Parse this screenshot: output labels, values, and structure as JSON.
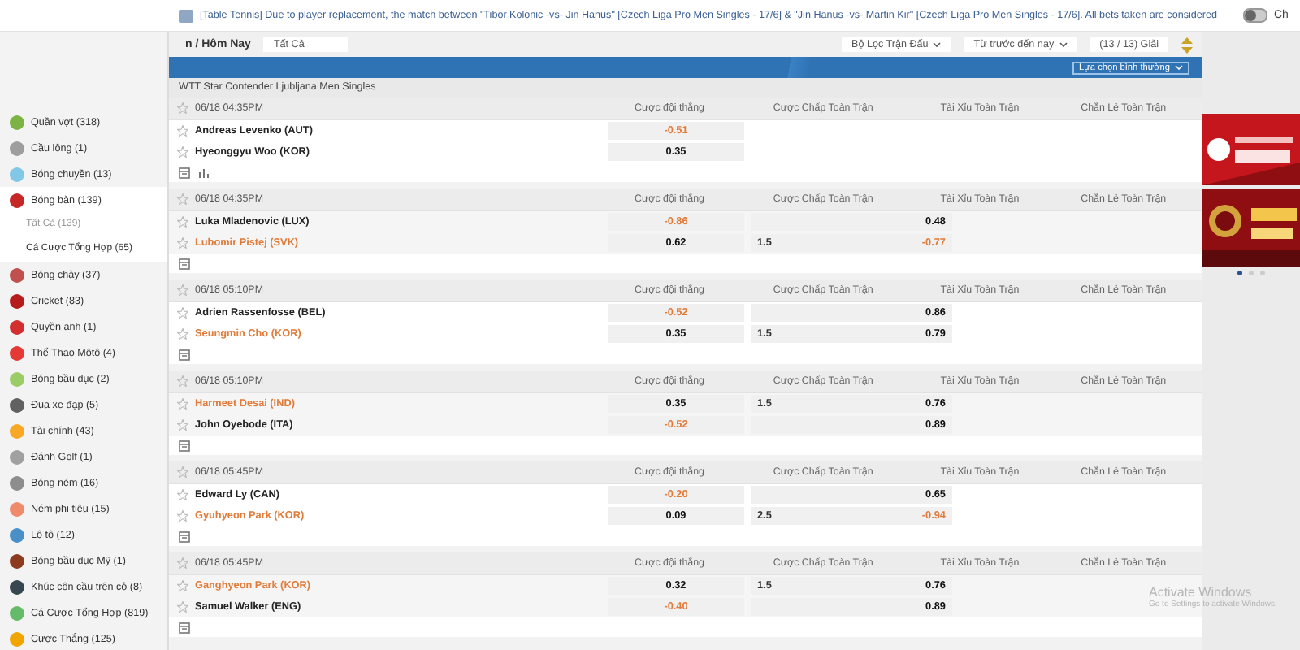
{
  "ticker": {
    "text": "[Table Tennis] Due to player replacement, the match between \"Tibor Kolonic -vs- Jin Hanus\" [Czech Liga Pro Men Singles - 17/6] & \"Jin Hanus -vs- Martin Kir\" [Czech Liga Pro Men Singles - 17/6]. All bets taken are considered",
    "toggle_label": "Ch",
    "toggle_on": false
  },
  "sidebar": {
    "items": [
      {
        "label": "Quần vợt (318)",
        "color": "#7cb342",
        "selected": false
      },
      {
        "label": "Cầu lông (1)",
        "color": "#9e9e9e",
        "selected": false
      },
      {
        "label": "Bóng chuyền (13)",
        "color": "#81c7e8",
        "selected": false
      },
      {
        "label": "Bóng bàn (139)",
        "color": "#c62828",
        "selected": true,
        "children": [
          {
            "label": "Tất Cả (139)",
            "selected": true
          },
          {
            "label": "Cá Cược Tổng Hợp (65)",
            "selected": false
          }
        ]
      },
      {
        "label": "Bóng chày (37)",
        "color": "#c0504d",
        "selected": false
      },
      {
        "label": "Cricket (83)",
        "color": "#b71c1c",
        "selected": false
      },
      {
        "label": "Quyền anh (1)",
        "color": "#d32f2f",
        "selected": false
      },
      {
        "label": "Thể Thao Môtô (4)",
        "color": "#e53935",
        "selected": false
      },
      {
        "label": "Bóng bầu dục (2)",
        "color": "#9ccc65",
        "selected": false
      },
      {
        "label": "Đua xe đạp (5)",
        "color": "#616161",
        "selected": false
      },
      {
        "label": "Tài chính (43)",
        "color": "#f9a825",
        "selected": false
      },
      {
        "label": "Đánh Golf (1)",
        "color": "#a0a0a0",
        "selected": false
      },
      {
        "label": "Bóng ném (16)",
        "color": "#8d8d8d",
        "selected": false
      },
      {
        "label": "Ném phi tiêu (15)",
        "color": "#ef8a6b",
        "selected": false
      },
      {
        "label": "Lô tô (12)",
        "color": "#4a90c8",
        "selected": false
      },
      {
        "label": "Bóng bầu dục Mỹ (1)",
        "color": "#8d3b1f",
        "selected": false
      },
      {
        "label": "Khúc côn cầu trên cỏ (8)",
        "color": "#37474f",
        "selected": false
      },
      {
        "label": "Cá Cược Tổng Hợp (819)",
        "color": "#66bb6a",
        "selected": false
      },
      {
        "label": "Cược Thắng (125)",
        "color": "#f0a500",
        "selected": false
      }
    ]
  },
  "filters": {
    "title": "n / Hôm Nay",
    "scope": "Tất Cả",
    "match_filter": "Bộ Lọc Trận Đấu",
    "period": "Từ trước đến nay",
    "leagues": "(13 / 13) Giải",
    "view": "Lựa chọn bình thường"
  },
  "league": "WTT Star Contender Ljubljana Men Singles",
  "matches": [
    {
      "time": "06/18 04:35PM",
      "columns": [
        "Cược đội thắng",
        "Cược Chấp Toàn Trận",
        "Tài Xỉu Toàn Trận",
        "Chẵn Lẻ Toàn Trận"
      ],
      "has_stats": true,
      "teams": [
        {
          "name": "Andreas Levenko (AUT)",
          "favored": false,
          "win": {
            "value": "-0.51",
            "negative": true
          }
        },
        {
          "name": "Hyeonggyu Woo (KOR)",
          "favored": false,
          "win": {
            "value": "0.35",
            "negative": false
          }
        }
      ]
    },
    {
      "time": "06/18 04:35PM",
      "columns": [
        "Cược đội thắng",
        "Cược Chấp Toàn Trận",
        "Tài Xỉu Toàn Trận",
        "Chẵn Lẻ Toàn Trận"
      ],
      "has_stats": false,
      "teams": [
        {
          "name": "Luka Mladenovic (LUX)",
          "favored": false,
          "win": {
            "value": "-0.86",
            "negative": true
          },
          "handicap": {
            "value": "0.48",
            "negative": false
          }
        },
        {
          "name": "Lubomir Pistej (SVK)",
          "favored": true,
          "win": {
            "value": "0.62",
            "negative": false
          },
          "handicap": {
            "line": "1.5",
            "value": "-0.77",
            "negative": true
          }
        }
      ]
    },
    {
      "time": "06/18 05:10PM",
      "columns": [
        "Cược đội thắng",
        "Cược Chấp Toàn Trận",
        "Tài Xỉu Toàn Trận",
        "Chẵn Lẻ Toàn Trận"
      ],
      "has_stats": false,
      "teams": [
        {
          "name": "Adrien Rassenfosse (BEL)",
          "favored": false,
          "win": {
            "value": "-0.52",
            "negative": true
          },
          "handicap": {
            "value": "0.86",
            "negative": false
          }
        },
        {
          "name": "Seungmin Cho (KOR)",
          "favored": true,
          "win": {
            "value": "0.35",
            "negative": false
          },
          "handicap": {
            "line": "1.5",
            "value": "0.79",
            "negative": false
          }
        }
      ]
    },
    {
      "time": "06/18 05:10PM",
      "columns": [
        "Cược đội thắng",
        "Cược Chấp Toàn Trận",
        "Tài Xỉu Toàn Trận",
        "Chẵn Lẻ Toàn Trận"
      ],
      "has_stats": false,
      "teams": [
        {
          "name": "Harmeet Desai (IND)",
          "favored": true,
          "win": {
            "value": "0.35",
            "negative": false
          },
          "handicap": {
            "line": "1.5",
            "value": "0.76",
            "negative": false
          }
        },
        {
          "name": "John Oyebode (ITA)",
          "favored": false,
          "win": {
            "value": "-0.52",
            "negative": true
          },
          "handicap": {
            "value": "0.89",
            "negative": false
          }
        }
      ]
    },
    {
      "time": "06/18 05:45PM",
      "columns": [
        "Cược đội thắng",
        "Cược Chấp Toàn Trận",
        "Tài Xỉu Toàn Trận",
        "Chẵn Lẻ Toàn Trận"
      ],
      "has_stats": false,
      "teams": [
        {
          "name": "Edward Ly (CAN)",
          "favored": false,
          "win": {
            "value": "-0.20",
            "negative": true
          },
          "handicap": {
            "value": "0.65",
            "negative": false
          }
        },
        {
          "name": "Gyuhyeon Park (KOR)",
          "favored": true,
          "win": {
            "value": "0.09",
            "negative": false
          },
          "handicap": {
            "line": "2.5",
            "value": "-0.94",
            "negative": true
          }
        }
      ]
    },
    {
      "time": "06/18 05:45PM",
      "columns": [
        "Cược đội thắng",
        "Cược Chấp Toàn Trận",
        "Tài Xỉu Toàn Trận",
        "Chẵn Lẻ Toàn Trận"
      ],
      "has_stats": false,
      "teams": [
        {
          "name": "Ganghyeon Park (KOR)",
          "favored": true,
          "win": {
            "value": "0.32",
            "negative": false
          },
          "handicap": {
            "line": "1.5",
            "value": "0.76",
            "negative": false
          }
        },
        {
          "name": "Samuel Walker (ENG)",
          "favored": false,
          "win": {
            "value": "-0.40",
            "negative": true
          },
          "handicap": {
            "value": "0.89",
            "negative": false
          }
        }
      ]
    }
  ],
  "os_notice": {
    "title": "Activate Windows",
    "text": "Go to Settings to activate Windows."
  }
}
